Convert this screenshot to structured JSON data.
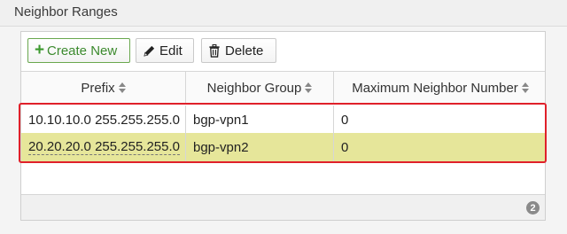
{
  "section": {
    "title": "Neighbor Ranges"
  },
  "toolbar": {
    "create_label": "Create New",
    "edit_label": "Edit",
    "delete_label": "Delete"
  },
  "table": {
    "columns": [
      "Prefix",
      "Neighbor Group",
      "Maximum Neighbor Number"
    ],
    "rows": [
      {
        "prefix": "10.10.10.0 255.255.255.0",
        "group": "bgp-vpn1",
        "max": "0",
        "selected": false
      },
      {
        "prefix": "20.20.20.0 255.255.255.0",
        "group": "bgp-vpn2",
        "max": "0",
        "selected": true
      }
    ]
  },
  "footer": {
    "count": "2"
  },
  "colors": {
    "selected_row": "#e6e69a",
    "highlight_border": "#e0202a",
    "create_accent": "#3c9a2e"
  }
}
